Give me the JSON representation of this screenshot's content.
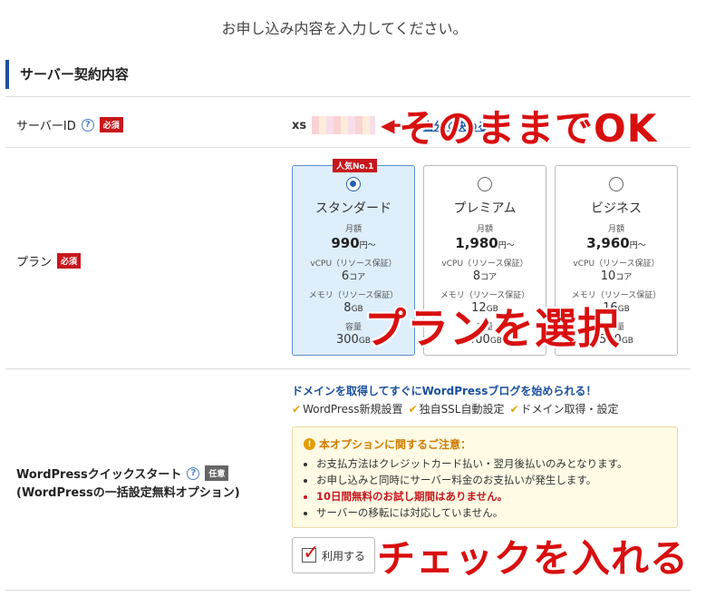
{
  "intro": "お申し込み内容を入力してください。",
  "section_title": "サーバー契約内容",
  "server_id": {
    "label": "サーバーID",
    "required": "必須",
    "prefix": "xs",
    "edit_link": "自分で決める"
  },
  "plan": {
    "label": "プラン",
    "required": "必須",
    "cards": [
      {
        "name": "スタンダード",
        "tag": "人気No.1",
        "selected": true,
        "monthly_label": "月額",
        "price": "990",
        "price_unit": "円～",
        "cpu_label": "vCPU（リソース保証）",
        "cpu": "6",
        "cpu_unit": "コア",
        "mem_label": "メモリ（リソース保証）",
        "mem": "8",
        "mem_unit": "GB",
        "disk_label": "容量",
        "disk": "300",
        "disk_unit": "GB"
      },
      {
        "name": "プレミアム",
        "tag": "",
        "selected": false,
        "monthly_label": "月額",
        "price": "1,980",
        "price_unit": "円～",
        "cpu_label": "vCPU（リソース保証）",
        "cpu": "8",
        "cpu_unit": "コア",
        "mem_label": "メモリ（リソース保証）",
        "mem": "12",
        "mem_unit": "GB",
        "disk_label": "容量",
        "disk": "400",
        "disk_unit": "GB"
      },
      {
        "name": "ビジネス",
        "tag": "",
        "selected": false,
        "monthly_label": "月額",
        "price": "3,960",
        "price_unit": "円～",
        "cpu_label": "vCPU（リソース保証）",
        "cpu": "10",
        "cpu_unit": "コア",
        "mem_label": "メモリ（リソース保証）",
        "mem": "16",
        "mem_unit": "GB",
        "disk_label": "容量",
        "disk": "500",
        "disk_unit": "GB"
      }
    ]
  },
  "wordpress": {
    "label": "WordPressクイックスタート",
    "optional": "任意",
    "sublabel": "(WordPressの一括設定無料オプション)",
    "lead": "ドメインを取得してすぐにWordPressブログを始められる！",
    "features": [
      "WordPress新規設置",
      "独自SSL自動設定",
      "ドメイン取得・設定"
    ],
    "notice_title": "本オプションに関するご注意：",
    "notices": [
      "お支払方法はクレジットカード払い・翌月後払いのみとなります。",
      "お申し込みと同時にサーバー料金のお支払いが発生します。",
      "10日間無料のお試し期間はありません。",
      "サーバーの移転には対応していません。"
    ],
    "use_label": "利用する"
  },
  "annotations": {
    "ok": "そのままでOK",
    "plan": "プランを選択",
    "check": "チェックを入れる"
  }
}
